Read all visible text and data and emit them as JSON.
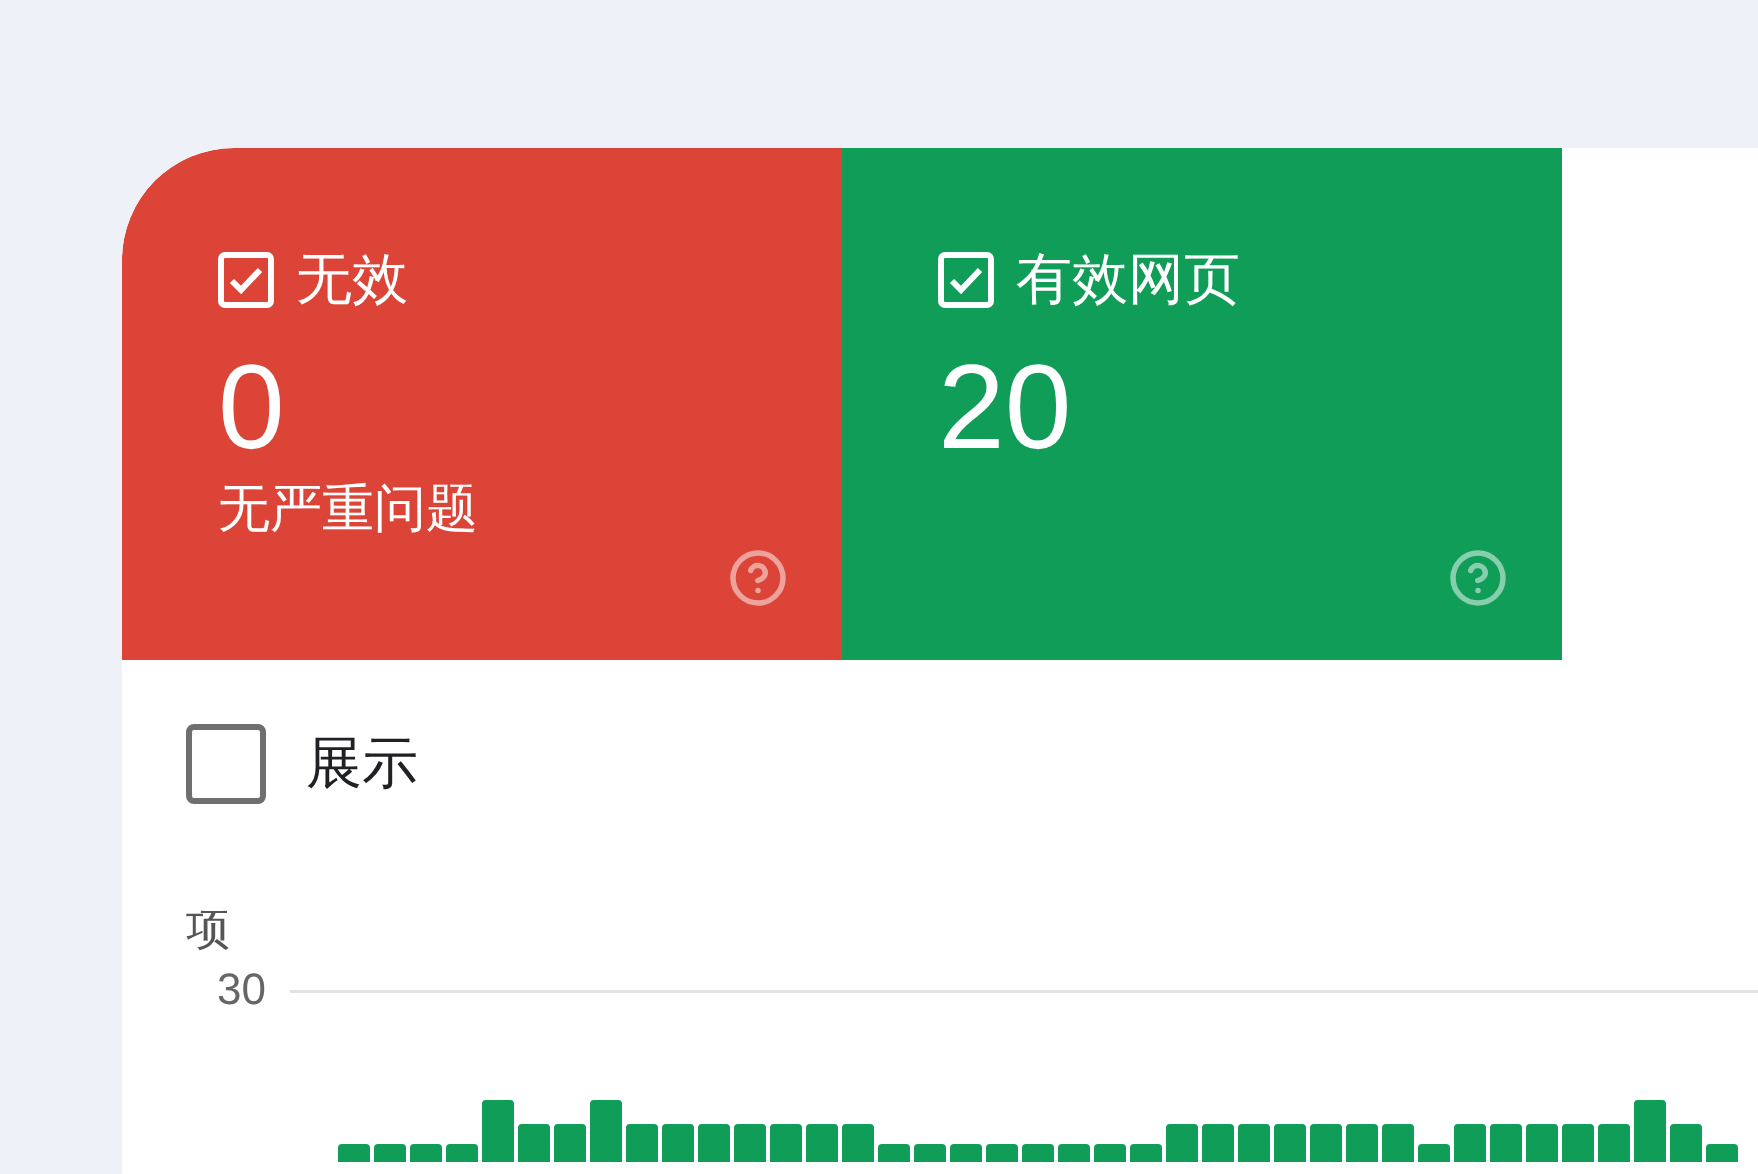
{
  "cards": [
    {
      "kind": "error",
      "title": "无效",
      "checked": true,
      "value": "0",
      "subtitle": "无严重问题"
    },
    {
      "kind": "valid",
      "title": "有效网页",
      "checked": true,
      "value": "20"
    }
  ],
  "display_toggle": {
    "label": "展示",
    "checked": false
  },
  "chart": {
    "y_axis_label": "项",
    "y_tick": "30"
  }
}
